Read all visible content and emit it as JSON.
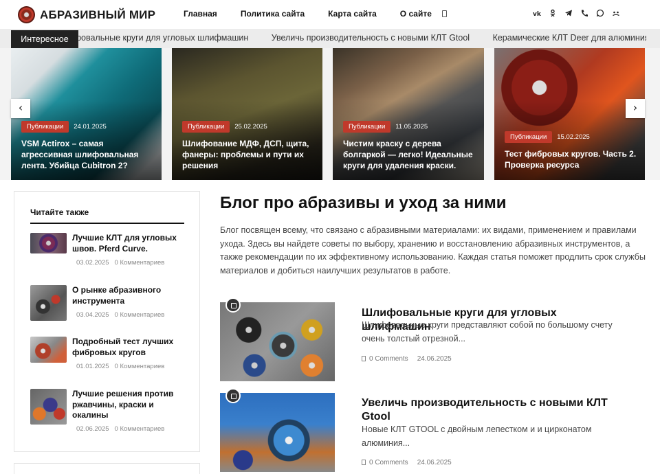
{
  "header": {
    "logo_text": "АБРАЗИВНЫЙ МИР",
    "nav": [
      "Главная",
      "Политика сайта",
      "Карта сайта",
      "О сайте"
    ],
    "socials": [
      "vk-icon",
      "odnoklassniki-icon",
      "telegram-icon",
      "phone-icon",
      "whatsapp-icon",
      "community-icon"
    ]
  },
  "ticker": {
    "label": "Интересное",
    "items": [
      "Шлифовальные круги для угловых шлифмашин",
      "Увеличь производительность с новыми КЛТ Gtool",
      "Керамические КЛТ Deer для алюминия"
    ]
  },
  "slider": {
    "cards": [
      {
        "tag": "Публикации",
        "date": "24.01.2025",
        "title": "VSM Actirox – самая агрессивная шлифовальная лента. Убийца Cubitron 2?"
      },
      {
        "tag": "Публикации",
        "date": "25.02.2025",
        "title": "Шлифование МДФ, ДСП, щита, фанеры: проблемы и пути их решения"
      },
      {
        "tag": "Публикации",
        "date": "11.05.2025",
        "title": "Чистим краску с дерева болгаркой — легко! Идеальные круги для удаления краски."
      },
      {
        "tag": "Публикации",
        "date": "15.02.2025",
        "title": "Тест фибровых кругов. Часть 2. Проверка ресурса"
      }
    ],
    "prev": "‹",
    "next": "›"
  },
  "sidebar": {
    "title": "Читайте также",
    "items": [
      {
        "title": "Лучшие КЛТ для угловых швов. Pferd Curve.",
        "date": "03.02.2025",
        "comments": "0 Комментариев"
      },
      {
        "title": "О рынке абразивного инструмента",
        "date": "03.04.2025",
        "comments": "0 Комментариев"
      },
      {
        "title": "Подробный тест лучших фибровых кругов",
        "date": "01.01.2025",
        "comments": "0 Комментариев"
      },
      {
        "title": "Лучшие решения против ржавчины, краски и окалины",
        "date": "02.06.2025",
        "comments": "0 Комментариев"
      }
    ]
  },
  "main": {
    "title": "Блог про абразивы и уход за ними",
    "description": "Блог посвящен всему, что связано с абразивными материалами: их видами, применением и правилами ухода. Здесь вы найдете советы по выбору, хранению и восстановлению абразивных инструментов, а также рекомендации по их эффективному использованию. Каждая статья поможет продлить срок службы материалов и добиться наилучших результатов в работе.",
    "posts": [
      {
        "title": "Шлифовальные круги для угловых шлифмашин",
        "excerpt": "Шлифовальные круги представляют собой по большому счету очень толстый отрезной...",
        "comments": "0 Comments",
        "date": "24.06.2025"
      },
      {
        "title": "Увеличь производительность с новыми КЛТ Gtool",
        "excerpt": "Новые КЛТ GTOOL с двойным лепестком и и цирконатом алюминия...",
        "comments": "0 Comments",
        "date": "24.06.2025"
      }
    ]
  },
  "colors": {
    "accent": "#c0392b",
    "dark": "#222222"
  }
}
